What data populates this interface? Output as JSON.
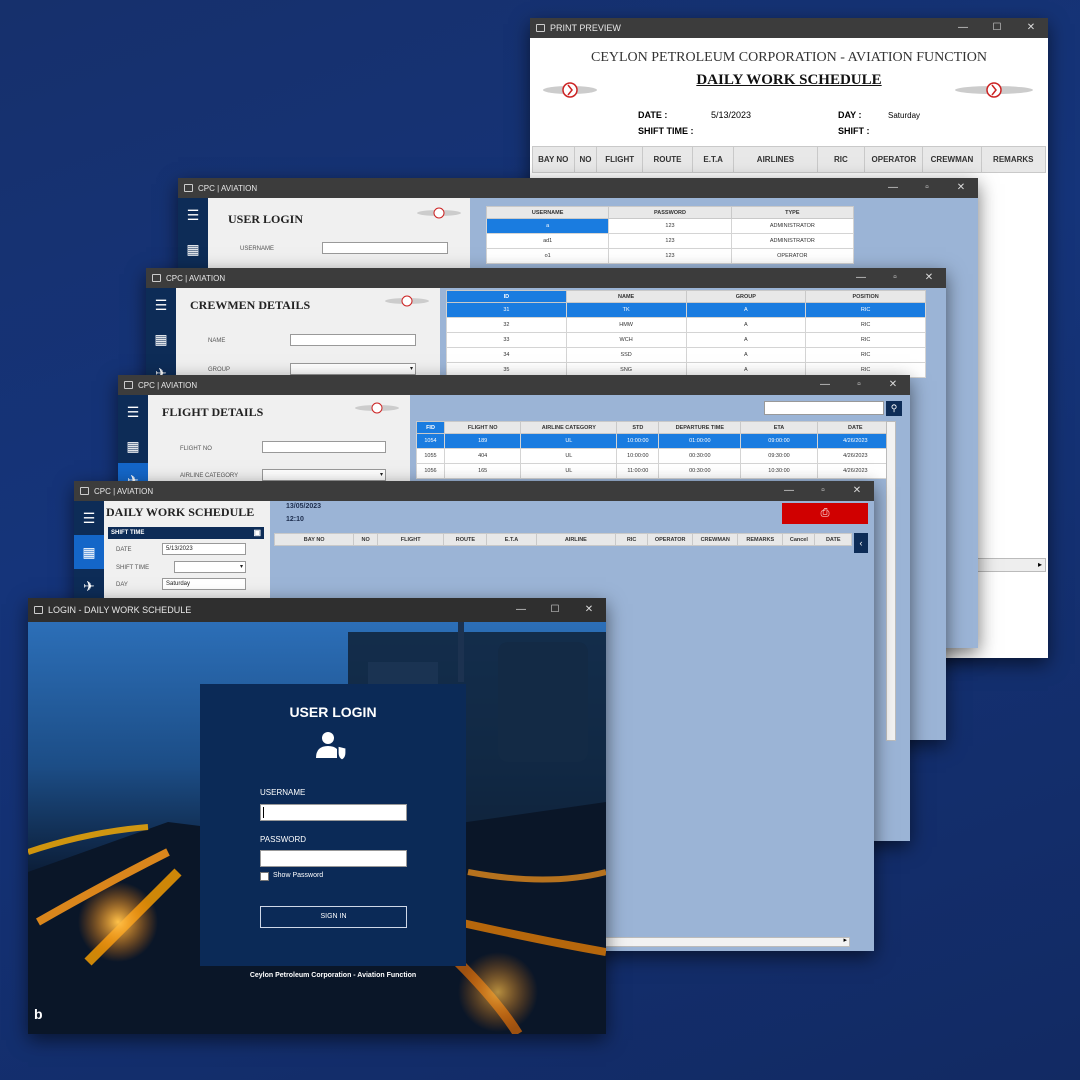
{
  "windows": {
    "print": {
      "title": "PRINT PREVIEW",
      "company": "CEYLON PETROLEUM CORPORATION - AVIATION FUNCTION",
      "heading": "DAILY WORK SCHEDULE",
      "date_label": "DATE :",
      "date_value": "5/13/2023",
      "day_label": "DAY :",
      "day_value": "Saturday",
      "shift_time_label": "SHIFT TIME :",
      "shift_label": "SHIFT :",
      "columns": [
        "BAY NO",
        "NO",
        "FLIGHT",
        "ROUTE",
        "E.T.A",
        "AIRLINES",
        "RIC",
        "OPERATOR",
        "CREWMAN",
        "REMARKS"
      ]
    },
    "user": {
      "title": "CPC | AVIATION",
      "heading": "USER LOGIN",
      "username_label": "USERNAME",
      "columns": [
        "USERNAME",
        "PASSWORD",
        "TYPE"
      ],
      "rows": [
        [
          "a",
          "123",
          "ADMINISTRATOR"
        ],
        [
          "ad1",
          "123",
          "ADMINISTRATOR"
        ],
        [
          "o1",
          "123",
          "OPERATOR"
        ]
      ]
    },
    "crew": {
      "title": "CPC | AVIATION",
      "heading": "CREWMEN DETAILS",
      "name_label": "NAME",
      "group_label": "GROUP",
      "columns": [
        "ID",
        "NAME",
        "GROUP",
        "POSITION"
      ],
      "rows": [
        [
          "31",
          "TK",
          "A",
          "RIC"
        ],
        [
          "32",
          "HMW",
          "A",
          "RIC"
        ],
        [
          "33",
          "WCH",
          "A",
          "RIC"
        ],
        [
          "34",
          "SSD",
          "A",
          "RIC"
        ],
        [
          "35",
          "SNG",
          "A",
          "RIC"
        ]
      ]
    },
    "flight": {
      "title": "CPC | AVIATION",
      "heading": "FLIGHT DETAILS",
      "flight_no_label": "FLIGHT NO",
      "airline_category_label": "AIRLINE CATEGORY",
      "columns": [
        "FID",
        "FLIGHT NO",
        "AIRLINE CATEGORY",
        "STD",
        "DEPARTURE TIME",
        "ETA",
        "DATE"
      ],
      "rows": [
        [
          "1054",
          "189",
          "UL",
          "10:00:00",
          "01:00:00",
          "09:00:00",
          "4/26/2023"
        ],
        [
          "1055",
          "404",
          "UL",
          "10:00:00",
          "00:30:00",
          "09:30:00",
          "4/26/2023"
        ],
        [
          "1056",
          "165",
          "UL",
          "11:00:00",
          "00:30:00",
          "10:30:00",
          "4/26/2023"
        ]
      ]
    },
    "daily": {
      "title": "CPC | AVIATION",
      "heading": "DAILY WORK SCHEDULE",
      "date_display": "13/05/2023",
      "time_display": "12:10",
      "shift_time_header": "SHIFT TIME",
      "date_label": "DATE",
      "date_value": "5/13/2023",
      "shift_time_label": "SHIFT TIME",
      "day_label": "DAY",
      "day_value": "Saturday",
      "columns": [
        "BAY NO",
        "NO",
        "FLIGHT",
        "ROUTE",
        "E.T.A",
        "AIRLINE",
        "RIC",
        "OPERATOR",
        "CREWMAN",
        "REMARKS",
        "Cancel",
        "DATE"
      ]
    },
    "login": {
      "title": "LOGIN - DAILY WORK SCHEDULE",
      "heading": "USER LOGIN",
      "username_label": "USERNAME",
      "password_label": "PASSWORD",
      "show_password": "Show Password",
      "sign_in": "SIGN IN",
      "footer": "Ceylon Petroleum Corporation - Aviation Function"
    }
  },
  "colors": {
    "background": "#15347a",
    "sidebar": "#0d2c57",
    "selection": "#1a7ce0",
    "print_button": "#d00000",
    "login_card": "#0b2a57"
  }
}
